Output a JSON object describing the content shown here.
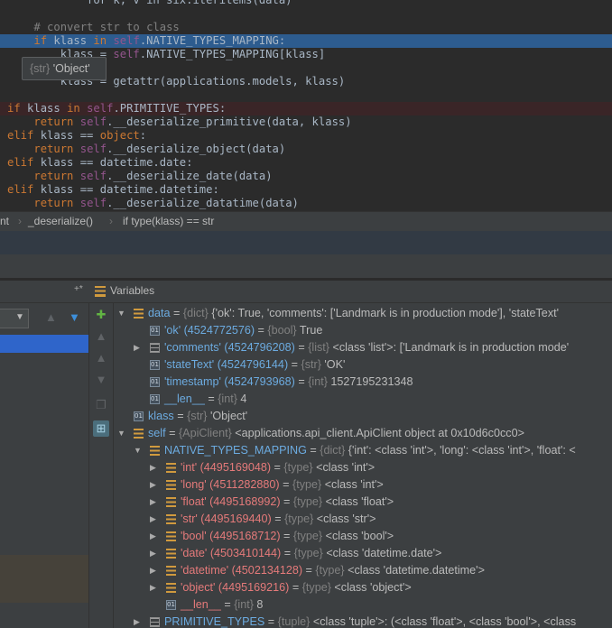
{
  "editor": {
    "lines": [
      {
        "segs": [
          {
            "t": "            for k, v in six.iteritems(data)",
            "c": ""
          }
        ]
      },
      {
        "segs": [
          {
            "t": "",
            "c": ""
          }
        ]
      },
      {
        "segs": [
          {
            "t": "    # convert str to class",
            "c": "cm"
          }
        ]
      },
      {
        "segs": [
          {
            "t": "    ",
            "c": ""
          },
          {
            "t": "if",
            "c": "kw"
          },
          {
            "t": " klass ",
            "c": ""
          },
          {
            "t": "in",
            "c": "kw"
          },
          {
            "t": " ",
            "c": ""
          },
          {
            "t": "self",
            "c": "sf"
          },
          {
            "t": ".NATIVE_TYPES_MAPPING:",
            "c": ""
          }
        ],
        "hl": true
      },
      {
        "segs": [
          {
            "t": "        klass = ",
            "c": ""
          },
          {
            "t": "self",
            "c": "sf"
          },
          {
            "t": ".NATIVE_TYPES_MAPPING[klass]",
            "c": ""
          }
        ]
      },
      {
        "segs": [
          {
            "t": "",
            "c": ""
          }
        ]
      },
      {
        "segs": [
          {
            "t": "        klass = getattr(applications.models, klass)",
            "c": ""
          }
        ]
      },
      {
        "segs": [
          {
            "t": "",
            "c": ""
          }
        ]
      },
      {
        "segs": [
          {
            "t": "if",
            "c": "kw"
          },
          {
            "t": " klass ",
            "c": ""
          },
          {
            "t": "in",
            "c": "kw"
          },
          {
            "t": " ",
            "c": ""
          },
          {
            "t": "self",
            "c": "sf"
          },
          {
            "t": ".PRIMITIVE_TYPES:",
            "c": ""
          }
        ],
        "err": true
      },
      {
        "segs": [
          {
            "t": "    ",
            "c": ""
          },
          {
            "t": "return",
            "c": "kw"
          },
          {
            "t": " ",
            "c": ""
          },
          {
            "t": "self",
            "c": "sf"
          },
          {
            "t": ".__deserialize_primitive(data, klass)",
            "c": ""
          }
        ]
      },
      {
        "segs": [
          {
            "t": "elif",
            "c": "kw"
          },
          {
            "t": " klass == ",
            "c": ""
          },
          {
            "t": "object",
            "c": "kw"
          },
          {
            "t": ":",
            "c": ""
          }
        ]
      },
      {
        "segs": [
          {
            "t": "    ",
            "c": ""
          },
          {
            "t": "return",
            "c": "kw"
          },
          {
            "t": " ",
            "c": ""
          },
          {
            "t": "self",
            "c": "sf"
          },
          {
            "t": ".__deserialize_object(data)",
            "c": ""
          }
        ]
      },
      {
        "segs": [
          {
            "t": "elif",
            "c": "kw"
          },
          {
            "t": " klass == datetime.date:",
            "c": ""
          }
        ]
      },
      {
        "segs": [
          {
            "t": "    ",
            "c": ""
          },
          {
            "t": "return",
            "c": "kw"
          },
          {
            "t": " ",
            "c": ""
          },
          {
            "t": "self",
            "c": "sf"
          },
          {
            "t": ".__deserialize_date(data)",
            "c": ""
          }
        ]
      },
      {
        "segs": [
          {
            "t": "elif",
            "c": "kw"
          },
          {
            "t": " klass == datetime.datetime:",
            "c": ""
          }
        ]
      },
      {
        "segs": [
          {
            "t": "    ",
            "c": ""
          },
          {
            "t": "return",
            "c": "kw"
          },
          {
            "t": " ",
            "c": ""
          },
          {
            "t": "self",
            "c": "sf"
          },
          {
            "t": ".__deserialize_datatime(data)",
            "c": ""
          }
        ]
      }
    ],
    "tooltip": {
      "type": "{str}",
      "value": "'Object'"
    }
  },
  "breadcrumbs": [
    "nt",
    "_deserialize()",
    "if type(klass) == str"
  ],
  "panel": {
    "title": "Variables",
    "pin": "+*"
  },
  "variables": [
    {
      "depth": 0,
      "arrow": "down",
      "icon": "bars",
      "name": "data",
      "nc": "nb",
      "eq": " = ",
      "type": "{dict}",
      "val": " {'ok': True, 'comments': ['Landmark is in production mode'], 'stateText'"
    },
    {
      "depth": 1,
      "arrow": "",
      "icon": "var",
      "name": "'ok' (4524772576)",
      "nc": "nb",
      "eq": " = ",
      "type": "{bool}",
      "val": " True"
    },
    {
      "depth": 1,
      "arrow": "right",
      "icon": "list",
      "name": "'comments' (4524796208)",
      "nc": "nb",
      "eq": " = ",
      "type": "{list}",
      "val": " <class 'list'>: ['Landmark is in production mode'"
    },
    {
      "depth": 1,
      "arrow": "",
      "icon": "var",
      "name": "'stateText' (4524796144)",
      "nc": "nb",
      "eq": " = ",
      "type": "{str}",
      "val": " 'OK'"
    },
    {
      "depth": 1,
      "arrow": "",
      "icon": "var",
      "name": "'timestamp' (4524793968)",
      "nc": "nb",
      "eq": " = ",
      "type": "{int}",
      "val": " 1527195231348"
    },
    {
      "depth": 1,
      "arrow": "",
      "icon": "var",
      "name": "__len__",
      "nc": "nb",
      "eq": " = ",
      "type": "{int}",
      "val": " 4"
    },
    {
      "depth": 0,
      "arrow": "",
      "icon": "var",
      "name": "klass",
      "nc": "nb",
      "eq": " = ",
      "type": "{str}",
      "val": " 'Object'"
    },
    {
      "depth": 0,
      "arrow": "down",
      "icon": "bars",
      "name": "self",
      "nc": "nb",
      "eq": " = ",
      "type": "{ApiClient}",
      "val": " <applications.api_client.ApiClient object at 0x10d6c0cc0>"
    },
    {
      "depth": 1,
      "arrow": "down",
      "icon": "bars",
      "name": "NATIVE_TYPES_MAPPING",
      "nc": "nb",
      "eq": " = ",
      "type": "{dict}",
      "val": " {'int': <class 'int'>, 'long': <class 'int'>, 'float': <"
    },
    {
      "depth": 2,
      "arrow": "right",
      "icon": "bars",
      "name": "'int' (4495169048)",
      "nc": "nr",
      "eq": " = ",
      "type": "{type}",
      "val": " <class 'int'>"
    },
    {
      "depth": 2,
      "arrow": "right",
      "icon": "bars",
      "name": "'long' (4511282880)",
      "nc": "nr",
      "eq": " = ",
      "type": "{type}",
      "val": " <class 'int'>"
    },
    {
      "depth": 2,
      "arrow": "right",
      "icon": "bars",
      "name": "'float' (4495168992)",
      "nc": "nr",
      "eq": " = ",
      "type": "{type}",
      "val": " <class 'float'>"
    },
    {
      "depth": 2,
      "arrow": "right",
      "icon": "bars",
      "name": "'str' (4495169440)",
      "nc": "nr",
      "eq": " = ",
      "type": "{type}",
      "val": " <class 'str'>"
    },
    {
      "depth": 2,
      "arrow": "right",
      "icon": "bars",
      "name": "'bool' (4495168712)",
      "nc": "nr",
      "eq": " = ",
      "type": "{type}",
      "val": " <class 'bool'>"
    },
    {
      "depth": 2,
      "arrow": "right",
      "icon": "bars",
      "name": "'date' (4503410144)",
      "nc": "nr",
      "eq": " = ",
      "type": "{type}",
      "val": " <class 'datetime.date'>"
    },
    {
      "depth": 2,
      "arrow": "right",
      "icon": "bars",
      "name": "'datetime' (4502134128)",
      "nc": "nr",
      "eq": " = ",
      "type": "{type}",
      "val": " <class 'datetime.datetime'>"
    },
    {
      "depth": 2,
      "arrow": "right",
      "icon": "bars",
      "name": "'object' (4495169216)",
      "nc": "nr",
      "eq": " = ",
      "type": "{type}",
      "val": " <class 'object'>"
    },
    {
      "depth": 2,
      "arrow": "",
      "icon": "var",
      "name": "__len__",
      "nc": "nr",
      "eq": " = ",
      "type": "{int}",
      "val": " 8"
    },
    {
      "depth": 1,
      "arrow": "right",
      "icon": "list",
      "name": "PRIMITIVE_TYPES",
      "nc": "nb",
      "eq": " = ",
      "type": "{tuple}",
      "val": " <class 'tuple'>: (<class 'float'>, <class 'bool'>, <class"
    }
  ],
  "toolbar_icons": [
    "add-watch-icon",
    "expand-icon",
    "collapse-icon",
    "arrow-down-icon",
    "copy-icon",
    "restore-layout-icon"
  ],
  "colors": {
    "selection": "#2d5c8f",
    "keyword": "#cc7832",
    "self": "#94558d",
    "name_blue": "#6cabe0",
    "name_red": "#e57a7a"
  }
}
